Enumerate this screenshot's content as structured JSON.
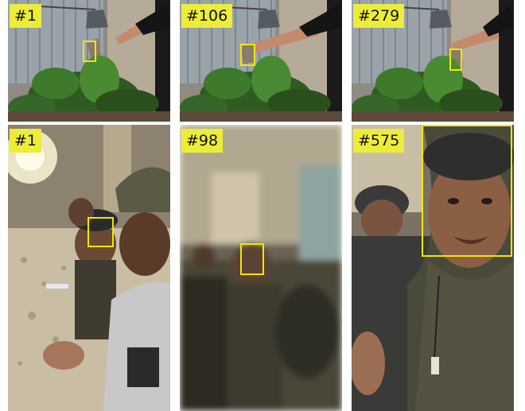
{
  "colors": {
    "label_bg": "#ecec3a",
    "label_text": "#111111",
    "bbox": "#f2e600"
  },
  "panels": [
    {
      "scene": "plant-lamp-hand",
      "frame_label": "#1"
    },
    {
      "scene": "plant-lamp-hand",
      "frame_label": "#106"
    },
    {
      "scene": "plant-lamp-hand",
      "frame_label": "#279"
    },
    {
      "scene": "party-selfie",
      "frame_label": "#1"
    },
    {
      "scene": "party-selfie-blurred",
      "frame_label": "#98"
    },
    {
      "scene": "party-selfie-closeup",
      "frame_label": "#575"
    }
  ]
}
